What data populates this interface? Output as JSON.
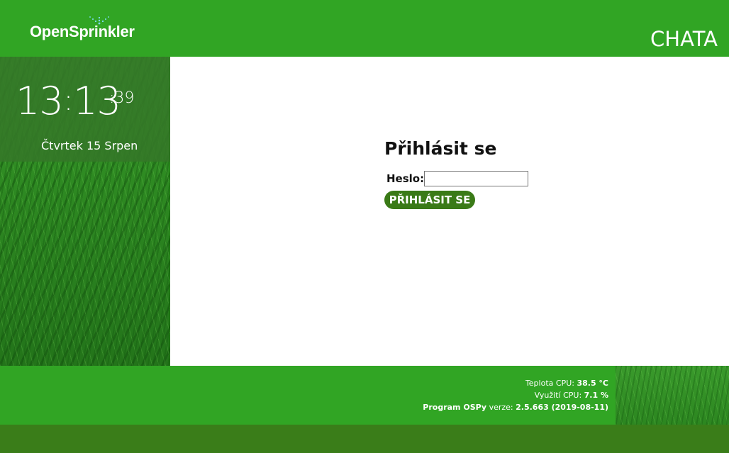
{
  "header": {
    "logo_text": "OpenSprinkler",
    "site_name": "CHATA"
  },
  "sidebar": {
    "clock": {
      "hours": "13",
      "separator": ":",
      "minutes": "13",
      "seconds": ":39"
    },
    "date": "Čtvrtek 15 Srpen"
  },
  "login": {
    "title": "Přihlásit se",
    "password_label": "Heslo:",
    "password_value": "",
    "button_label": "PŘIHLÁSIT SE"
  },
  "footer": {
    "cpu_temp_label": "Teplota CPU:",
    "cpu_temp_value": "38.5 °C",
    "cpu_usage_label": "Využití CPU:",
    "cpu_usage_value": "7.1 %",
    "program_name": "Program OSPy",
    "version_label": "verze:",
    "version_value": "2.5.663 (2019-08-11)"
  },
  "colors": {
    "brand_green": "#31a524",
    "button_green": "#3a7a17",
    "bottom_bar": "#3a7d19"
  }
}
